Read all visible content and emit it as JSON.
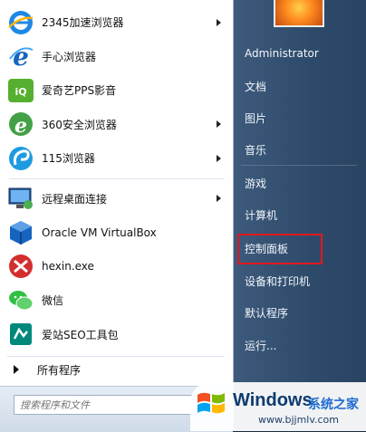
{
  "apps": [
    {
      "label": "2345加速浏览器",
      "icon": "2345-browser-icon",
      "has_submenu": true
    },
    {
      "label": "手心浏览器",
      "icon": "shouxin-browser-icon",
      "has_submenu": false
    },
    {
      "label": "爱奇艺PPS影音",
      "icon": "iqiyi-pps-icon",
      "has_submenu": false
    },
    {
      "label": "360安全浏览器",
      "icon": "360-browser-icon",
      "has_submenu": true
    },
    {
      "label": "115浏览器",
      "icon": "115-browser-icon",
      "has_submenu": true
    },
    {
      "label": "远程桌面连接",
      "icon": "remote-desktop-icon",
      "has_submenu": true
    },
    {
      "label": "Oracle VM VirtualBox",
      "icon": "virtualbox-icon",
      "has_submenu": false
    },
    {
      "label": "hexin.exe",
      "icon": "hexin-icon",
      "has_submenu": false
    },
    {
      "label": "微信",
      "icon": "wechat-icon",
      "has_submenu": false
    },
    {
      "label": "爱站SEO工具包",
      "icon": "aizhan-seo-icon",
      "has_submenu": false
    }
  ],
  "all_programs": "所有程序",
  "search_placeholder": "搜索程序和文件",
  "right": {
    "user": "Administrator",
    "items": [
      "文档",
      "图片",
      "音乐",
      "游戏",
      "计算机",
      "控制面板",
      "设备和打印机",
      "默认程序",
      "运行..."
    ]
  },
  "highlighted_item": "控制面板",
  "highlight_color": "#e0191e",
  "watermark": {
    "brand": "Windows",
    "suffix": "系统之家",
    "url": "www.bjjmlv.com"
  }
}
